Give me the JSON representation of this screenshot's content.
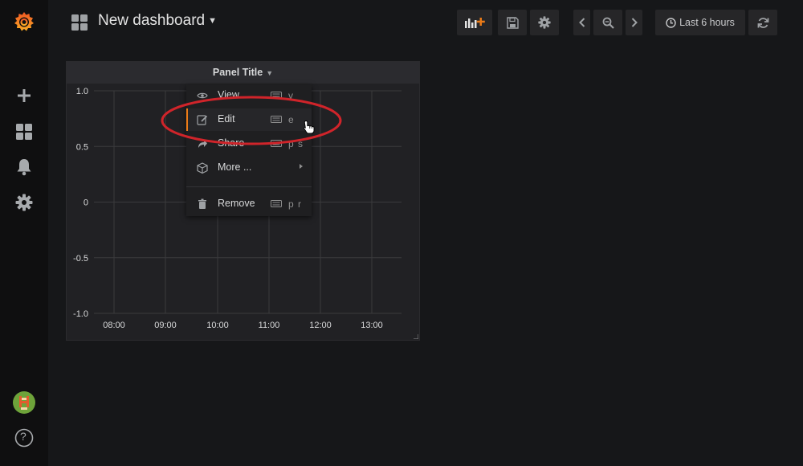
{
  "navbar": {
    "dashboard_title": "New dashboard",
    "time_range_label": "Last 6 hours",
    "icons": [
      "dashboards-grid-icon",
      "add-panel-icon",
      "save-icon",
      "settings-icon",
      "chevron-left-icon",
      "zoom-out-icon",
      "chevron-right-icon",
      "clock-icon",
      "refresh-icon"
    ]
  },
  "sidemenu": {
    "items": [
      "grafana-logo",
      "plus-icon",
      "dashboards-icon",
      "alerting-bell-icon",
      "configuration-gear-icon",
      "user-avatar",
      "help-icon"
    ],
    "help_label": "?"
  },
  "panel": {
    "title": "Panel Title",
    "menu": {
      "items": [
        {
          "label": "View",
          "shortcut": "v",
          "icon": "eye-icon"
        },
        {
          "label": "Edit",
          "shortcut": "e",
          "icon": "edit-icon",
          "active": true
        },
        {
          "label": "Share",
          "shortcut": "p s",
          "icon": "share-icon"
        },
        {
          "label": "More ...",
          "shortcut": "",
          "icon": "cube-icon",
          "has_submenu": true
        },
        {
          "label": "Remove",
          "shortcut": "p r",
          "icon": "trash-icon"
        }
      ]
    }
  },
  "chart_data": {
    "type": "line",
    "title": "",
    "xlabel": "",
    "ylabel": "",
    "x_ticks": [
      "08:00",
      "09:00",
      "10:00",
      "11:00",
      "12:00",
      "13:00"
    ],
    "y_ticks": [
      "1.0",
      "0.5",
      "0",
      "-0.5",
      "-1.0"
    ],
    "ylim": [
      -1.0,
      1.0
    ],
    "grid": true,
    "series": []
  },
  "colors": {
    "accent": "#eb7b18",
    "annotation": "#d0242a",
    "background": "#161719",
    "panel_bg": "#212124"
  }
}
